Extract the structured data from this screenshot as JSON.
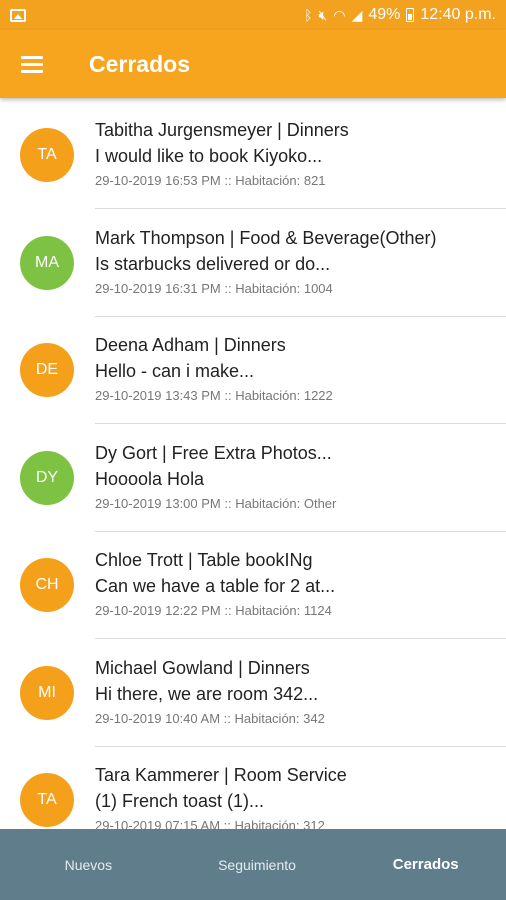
{
  "status_bar": {
    "battery_percent": "49%",
    "time": "12:40 p.m.",
    "icons": [
      "image-icon",
      "bluetooth-icon",
      "mute-icon",
      "wifi-icon",
      "signal-icon",
      "battery-icon"
    ]
  },
  "app_bar": {
    "title": "Cerrados",
    "menu_icon": "hamburger-menu-icon",
    "color": "#f7a51e"
  },
  "conversations": [
    {
      "initials": "TA",
      "avatar_color": "#f5a01a",
      "title": "Tabitha Jurgensmeyer | Dinners",
      "message": "I would like to book Kiyoko...",
      "meta": "29-10-2019 16:53 PM :: Habitación: 821"
    },
    {
      "initials": "MA",
      "avatar_color": "#7dc242",
      "title": "Mark Thompson | Food & Beverage(Other)",
      "message": "Is starbucks delivered or do...",
      "meta": "29-10-2019 16:31 PM :: Habitación: 1004"
    },
    {
      "initials": "DE",
      "avatar_color": "#f5a01a",
      "title": "Deena Adham | Dinners",
      "message": "Hello - can i make...",
      "meta": "29-10-2019 13:43 PM :: Habitación: 1222"
    },
    {
      "initials": "DY",
      "avatar_color": "#7dc242",
      "title": "Dy Gort | Free Extra Photos...",
      "message": "Hooool​a Hola",
      "meta": "29-10-2019 13:00 PM :: Habitación: Other"
    },
    {
      "initials": "CH",
      "avatar_color": "#f5a01a",
      "title": "Chloe Trott | Table bookINg",
      "message": "Can we have a table for 2 at...",
      "meta": "29-10-2019 12:22 PM :: Habitación: 1124"
    },
    {
      "initials": "MI",
      "avatar_color": "#f5a01a",
      "title": "Michael Gowland | Dinners",
      "message": "Hi there, we are room 342...",
      "meta": "29-10-2019 10:40 AM :: Habitación: 342"
    },
    {
      "initials": "TA",
      "avatar_color": "#f5a01a",
      "title": "Tara Kammerer | Room Service",
      "message": "(1) French toast (1)...",
      "meta": "29-10-2019 07:15 AM :: Habitación: 312"
    }
  ],
  "bottom_nav": {
    "tabs": [
      {
        "label": "Nuevos",
        "active": false
      },
      {
        "label": "Seguimiento",
        "active": false
      },
      {
        "label": "Cerrados",
        "active": true
      }
    ],
    "color": "#607d8b"
  }
}
